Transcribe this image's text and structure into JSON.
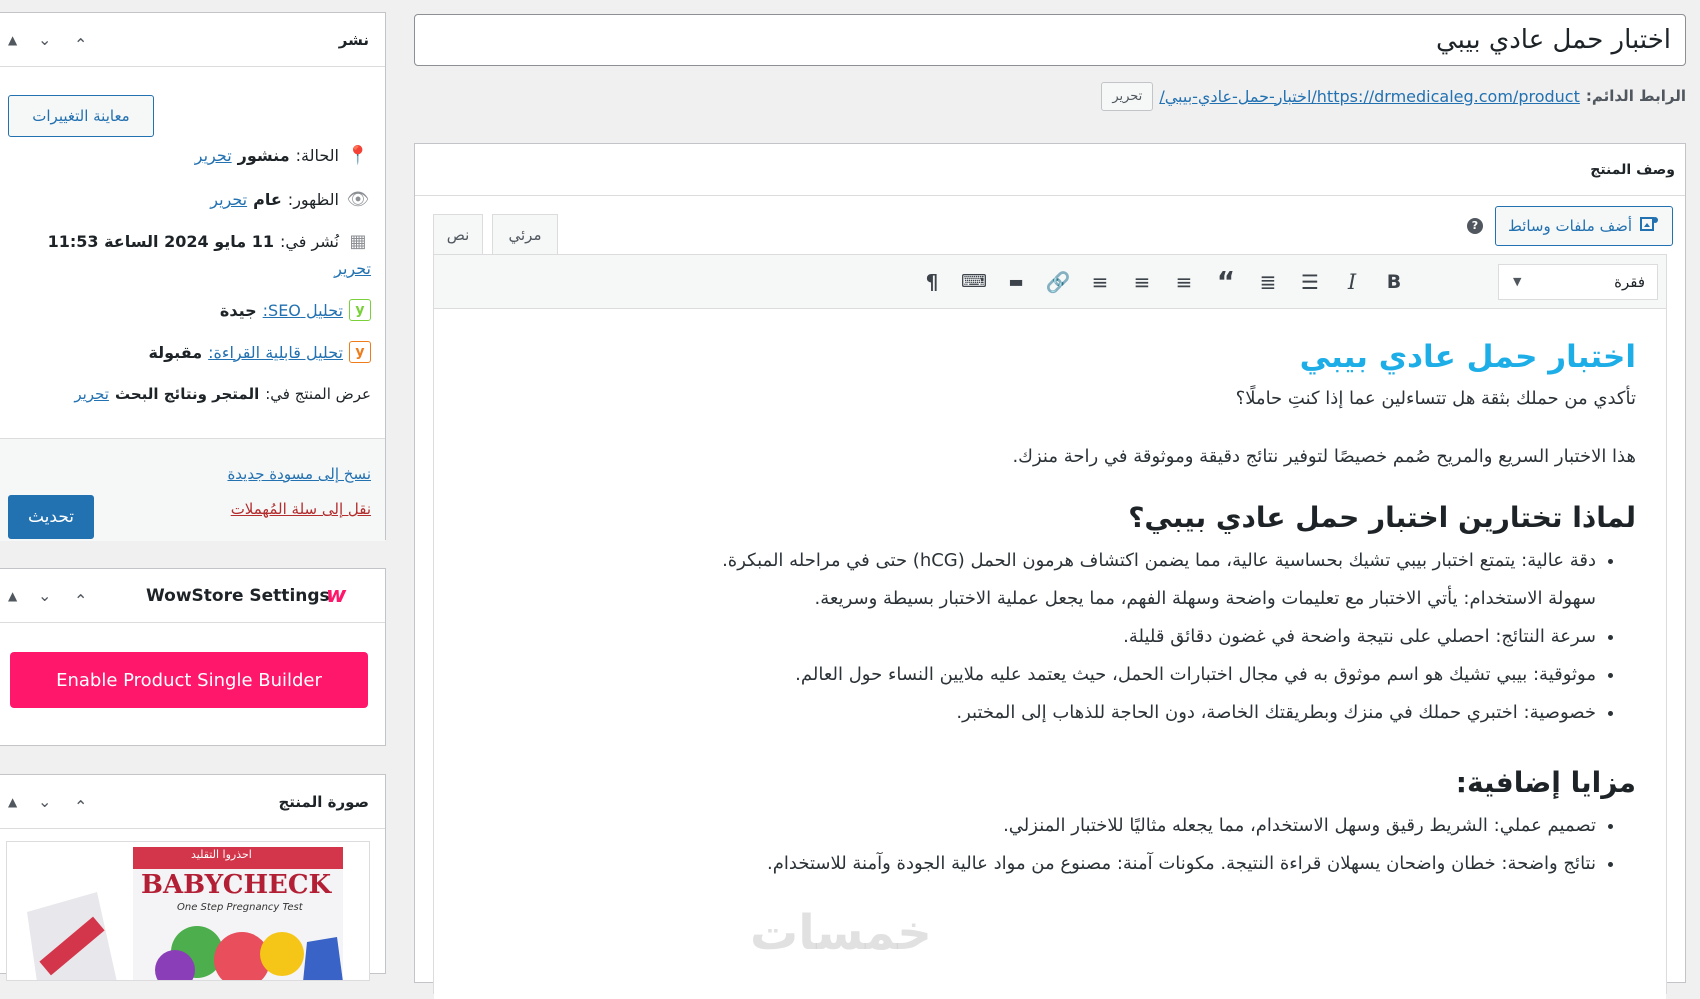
{
  "main": {
    "post_title": "اختبار حمل عادي بيبي",
    "permalink": {
      "label": "الرابط الدائم:",
      "url_text": "https://drmedicaleg.com/product/اختبار-حمل-عادي-بيبي/",
      "edit_label": "تحرير"
    },
    "description_box": {
      "title": "وصف المنتج",
      "add_media_label": "أضف ملفات وسائط",
      "tabs": {
        "visual": "مرئي",
        "text": "نص"
      },
      "format_select": "فقرة"
    },
    "content": {
      "heading": "اختبار حمل عادي بيبي",
      "intro": "تأكدي من حملك بثقة هل تتساءلين عما إذا كنتِ حاملًا؟",
      "paragraph": "هذا الاختبار السريع والمريح صُمم خصيصًا لتوفير نتائج دقيقة وموثوقة في راحة منزك.",
      "why_heading": "لماذا تختارين اختبار حمل عادي بيبي؟",
      "why_items": [
        "دقة عالية: يتمتع اختبار بيبي تشيك بحساسية عالية، مما يضمن اكتشاف هرمون الحمل (hCG) حتى في مراحله المبكرة.",
        "سهولة الاستخدام: يأتي الاختبار مع تعليمات واضحة وسهلة الفهم، مما يجعل عملية الاختبار بسيطة وسريعة.",
        "سرعة النتائج: احصلي على نتيجة واضحة في غضون دقائق قليلة.",
        "موثوقية: بيبي تشيك هو اسم موثوق به في مجال اختبارات الحمل، حيث يعتمد عليه ملايين النساء حول العالم.",
        "خصوصية: اختبري حملك في منزك وبطريقتك الخاصة، دون الحاجة للذهاب إلى المختبر."
      ],
      "extra_heading": "مزايا إضافية:",
      "extra_items": [
        "تصميم عملي: الشريط رقيق وسهل الاستخدام، مما يجعله مثاليًا للاختبار المنزلي.",
        "نتائج واضحة: خطان واضحان يسهلان قراءة النتيجة. مكونات آمنة: مصنوع من مواد عالية الجودة وآمنة للاستخدام."
      ]
    }
  },
  "sidebar": {
    "publish": {
      "title": "نشر",
      "preview_label": "معاينة التغييرات",
      "status_label": "الحالة:",
      "status_value": "منشور",
      "visibility_label": "الظهور:",
      "visibility_value": "عام",
      "published_label": "نُشر في:",
      "published_value": "11 مايو 2024 الساعة 11:53",
      "edit_label": "تحرير",
      "seo_label": "تحليل SEO:",
      "seo_value": "جيدة",
      "readability_label": "تحليل قابلية القراءة:",
      "readability_value": "مقبولة",
      "catalog_label": "عرض المنتج في:",
      "catalog_value": "المتجر ونتائج البحث",
      "copy_label": "نسخ إلى مسودة جديدة",
      "trash_label": "نقل إلى سلة المُهملات",
      "update_label": "تحديث"
    },
    "wowstore": {
      "title": "WowStore Settings",
      "logo": "w",
      "builder_button": "Enable Product Single Builder"
    },
    "product_image": {
      "title": "صورة المنتج",
      "package_text": "BABYCHECK",
      "package_sub": "One Step Pregnancy Test",
      "package_top": "احذروا التقليد"
    }
  },
  "watermark": "خمسات",
  "colors": {
    "accent": "#2271b1",
    "builder": "#ff176b",
    "heading_blue": "#1eaee7"
  }
}
